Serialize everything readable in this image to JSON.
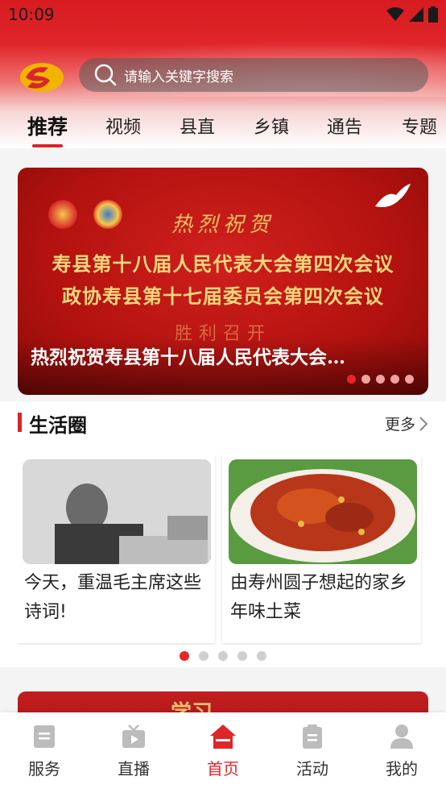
{
  "status_bar": {
    "time": "10:09"
  },
  "search": {
    "placeholder": "请输入关键字搜索"
  },
  "tabs": [
    {
      "label": "推荐",
      "active": true
    },
    {
      "label": "视频"
    },
    {
      "label": "县直"
    },
    {
      "label": "乡镇"
    },
    {
      "label": "通告"
    },
    {
      "label": "专题"
    }
  ],
  "banner": {
    "art_heading": "热烈祝贺",
    "art_line1": "寿县第十八届人民代表大会第四次会议",
    "art_line2": "政协寿县第十七届委员会第四次会议",
    "art_subtitle": "胜利召开",
    "caption": "热烈祝贺寿县第十八届人民代表大会…",
    "slide_count": 5,
    "active_slide": 1
  },
  "life_circle": {
    "title": "生活圈",
    "more_label": "更多",
    "cards": [
      {
        "text": "今天，重温毛主席这些诗词!"
      },
      {
        "text": "由寿州圆子想起的家乡年味土菜"
      }
    ],
    "page_count": 5,
    "active_page": 1
  },
  "next_banner": {
    "partial_text": "学习"
  },
  "bottom_nav": [
    {
      "label": "服务",
      "icon": "document-icon"
    },
    {
      "label": "直播",
      "icon": "tv-icon"
    },
    {
      "label": "首页",
      "icon": "home-icon",
      "active": true
    },
    {
      "label": "活动",
      "icon": "clipboard-icon"
    },
    {
      "label": "我的",
      "icon": "user-icon"
    }
  ],
  "colors": {
    "accent": "#e0262a",
    "header_red": "#d71b20",
    "gold_text": "#f6d77c"
  }
}
